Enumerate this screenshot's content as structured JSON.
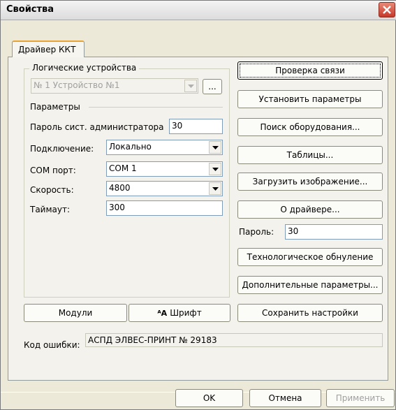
{
  "window": {
    "title": "Свойства"
  },
  "tabs": [
    {
      "label": "Драйвер ККТ"
    }
  ],
  "logical_devices": {
    "group_label": "Логические устройства",
    "device_value": "№ 1 Устройство №1",
    "browse_label": "..."
  },
  "parameters": {
    "section_label": "Параметры",
    "admin_password_label": "Пароль сист. администратора",
    "admin_password_value": "30",
    "connection_label": "Подключение:",
    "connection_value": "Локально",
    "com_port_label": "COM порт:",
    "com_port_value": "COM 1",
    "speed_label": "Скорость:",
    "speed_value": "4800",
    "timeout_label": "Таймаут:",
    "timeout_value": "300"
  },
  "right_buttons": {
    "check_connection": "Проверка связи",
    "set_parameters": "Установить параметры",
    "search_equipment": "Поиск оборудования...",
    "tables": "Таблицы...",
    "load_image": "Загрузить изображение...",
    "about_driver": "О драйвере..."
  },
  "password": {
    "label": "Пароль:",
    "value": "30"
  },
  "tech_buttons": {
    "tech_reset": "Технологическое обнуление",
    "extra_params": "Дополнительные параметры...",
    "save_settings": "Сохранить настройки"
  },
  "left_buttons": {
    "modules": "Модули",
    "font": "Шрифт",
    "font_icon": "ᴬA"
  },
  "error": {
    "label": "Код ошибки:",
    "value": "АСПД ЭЛВЕС-ПРИНТ № 29183"
  },
  "dialog_buttons": {
    "ok": "OK",
    "cancel": "Отмена",
    "apply": "Применить"
  }
}
